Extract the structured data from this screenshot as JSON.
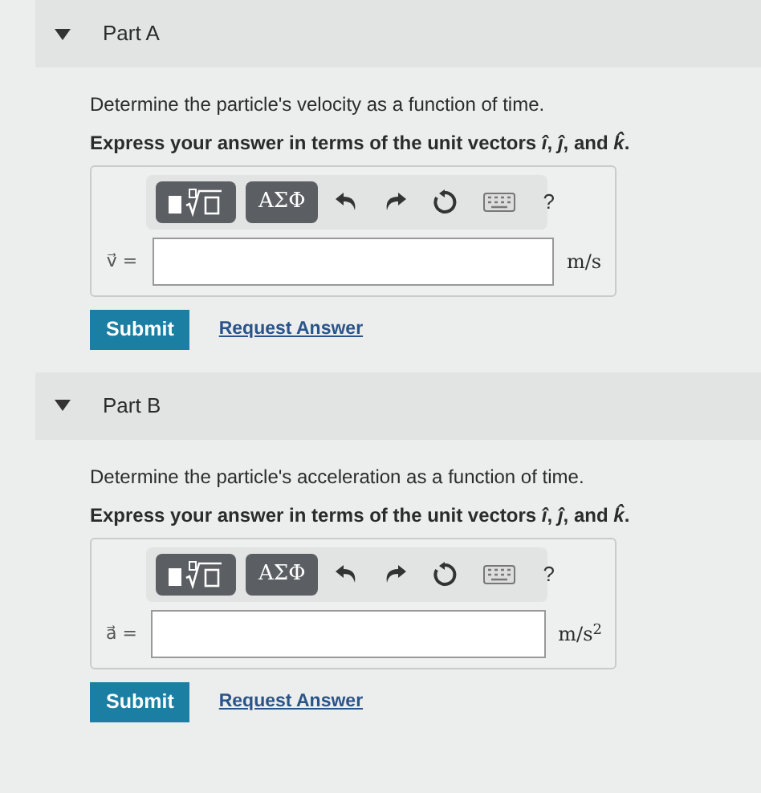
{
  "parts": [
    {
      "title": "Part A",
      "expanded": true,
      "prompt": "Determine the particle's velocity as a function of time.",
      "instruction": "Express your answer in terms of the unit vectors *î*, *ĵ*, and *k̂*.",
      "toolbar": {
        "symbols": "ΑΣΦ",
        "help": "?"
      },
      "variable": "v⃗ =",
      "unit": "m/s",
      "submit": "Submit",
      "request": "Request Answer"
    },
    {
      "title": "Part B",
      "expanded": true,
      "prompt": "Determine the particle's acceleration as a function of time.",
      "instruction": "Express your answer in terms of the unit vectors *î*, *ĵ*, and *k̂*.",
      "toolbar": {
        "symbols": "ΑΣΦ",
        "help": "?"
      },
      "variable": "a⃗ =",
      "unit": "m/s$^{2}$",
      "submit": "Submit",
      "request": "Request Answer"
    }
  ]
}
